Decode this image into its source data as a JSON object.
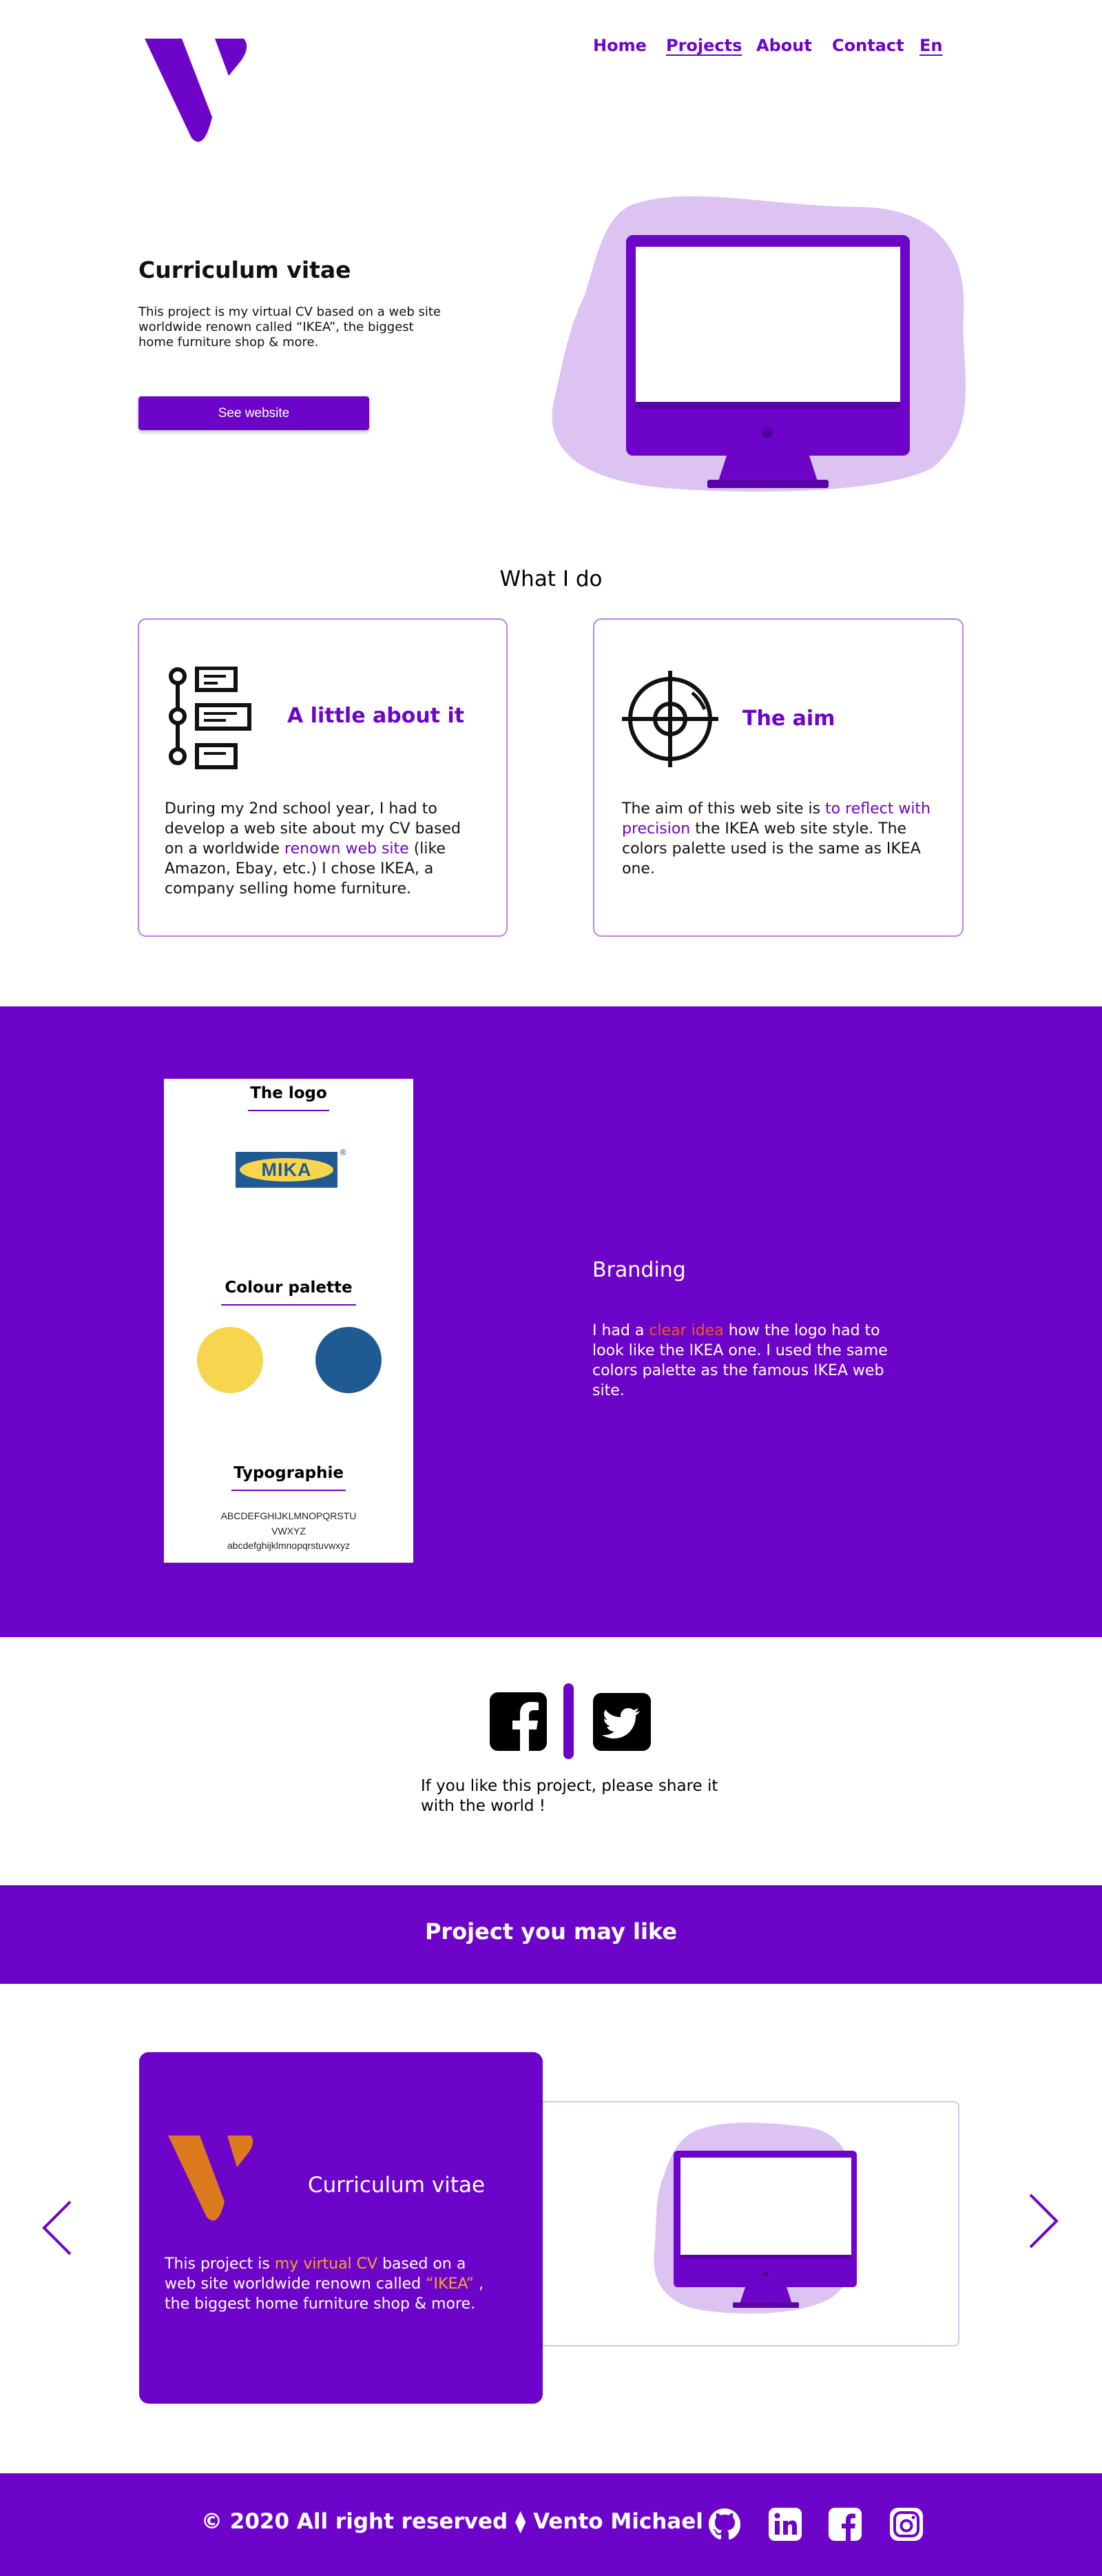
{
  "nav": {
    "home": "Home",
    "projects": "Projects",
    "about": "About",
    "contact": "Contact",
    "lang": "En"
  },
  "hero": {
    "title": "Curriculum vitae",
    "text": "This project is my virtual CV based on a web site worldwide renown called “IKEA”, the biggest home furniture shop & more.",
    "button": "See website"
  },
  "what_i_do": {
    "title": "What I do",
    "card1": {
      "title": "A little about it",
      "text_before": "During my 2nd school year, I had to develop a web site about my CV based on a worldwide ",
      "highlight": "renown web site",
      "text_after": " (like Amazon, Ebay, etc.) I chose IKEA, a company selling home furniture."
    },
    "card2": {
      "title": "The aim",
      "text_before": "The aim of this web site is ",
      "highlight": "to reflect with precision",
      "text_after": " the IKEA web site style. The colors palette used is the same as IKEA one."
    }
  },
  "branding": {
    "panel": {
      "logo_heading": "The logo",
      "logo_word": "MIKA",
      "logo_mark": "®",
      "palette_heading": "Colour palette",
      "colors": [
        "#f7d54e",
        "#1f5a92"
      ],
      "typo_heading": "Typographie",
      "typo_upper": "ABCDEFGHIJKLMNOPQRSTU VWXYZ",
      "typo_lower": "abcdefghijklmnopqrstuvwxyz"
    },
    "title": "Branding",
    "text_before": "I had a ",
    "highlight": "clear idea",
    "text_after": " how the logo had to look like the IKEA one. I used the same colors palette as the famous IKEA web site."
  },
  "share": {
    "text": "If you like this project, please share it with the world !"
  },
  "project_band": {
    "title": "Project you may like"
  },
  "carousel": {
    "title": "Curriculum vitae",
    "text_1": "This project is ",
    "highlight_1": "my virtual CV ",
    "text_2": " based on a web site worldwide renown called ",
    "highlight_2": "“IKEA”",
    "text_3": " , the biggest home furniture shop & more."
  },
  "footer": {
    "text": "© 2020 All right reserved ⧫ Vento Michael"
  },
  "colors": {
    "brand_purple": "#6d04c9",
    "light_purple": "#dcc3f2",
    "orange": "#dd7a1d",
    "highlight_red": "#f2571d"
  },
  "icons": [
    "logo-v-icon",
    "monitor-icon",
    "timeline-list-icon",
    "target-icon",
    "facebook-icon",
    "twitter-icon",
    "chevron-left-icon",
    "chevron-right-icon",
    "github-icon",
    "linkedin-icon",
    "instagram-icon"
  ]
}
